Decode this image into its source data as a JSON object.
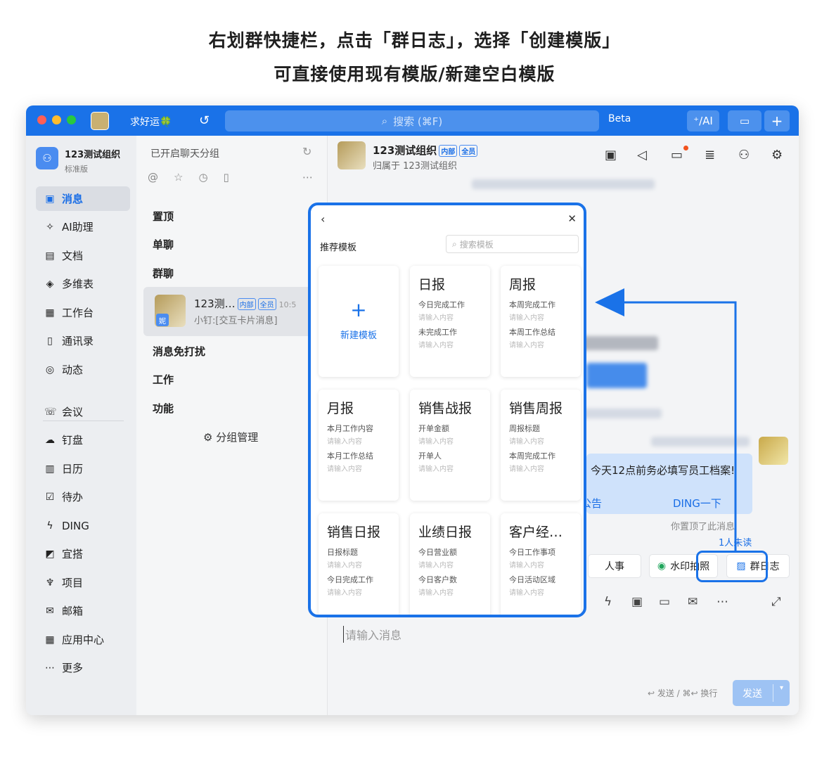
{
  "caption": {
    "line1": "右划群快捷栏，点击「群日志」，选择「创建模版」",
    "line2": "可直接使用现有模版/新建空白模版"
  },
  "titlebar": {
    "status": "求好运🍀",
    "search_placeholder": "搜索 (⌘F)",
    "beta": "Beta",
    "ai_btn": "⁺/AI",
    "add_btn": "+"
  },
  "sidebar": {
    "org_name": "123测试组织",
    "org_edition": "标准版",
    "items": [
      {
        "label": "消息",
        "icon": "message-icon"
      },
      {
        "label": "AI助理",
        "icon": "ai-icon"
      },
      {
        "label": "文档",
        "icon": "doc-icon"
      },
      {
        "label": "多维表",
        "icon": "table-icon"
      },
      {
        "label": "工作台",
        "icon": "grid-icon"
      },
      {
        "label": "通讯录",
        "icon": "contacts-icon"
      },
      {
        "label": "动态",
        "icon": "feed-icon"
      },
      {
        "label": "会议",
        "icon": "meeting-icon"
      },
      {
        "label": "钉盘",
        "icon": "cloud-icon"
      },
      {
        "label": "日历",
        "icon": "calendar-icon"
      },
      {
        "label": "待办",
        "icon": "todo-icon"
      },
      {
        "label": "DING",
        "icon": "ding-icon"
      },
      {
        "label": "宜搭",
        "icon": "yida-icon"
      },
      {
        "label": "项目",
        "icon": "project-icon"
      },
      {
        "label": "邮箱",
        "icon": "mail-icon"
      },
      {
        "label": "应用中心",
        "icon": "apps-icon"
      },
      {
        "label": "更多",
        "icon": "more-icon"
      }
    ]
  },
  "list": {
    "header": "已开启聊天分组",
    "sections": [
      "置顶",
      "单聊",
      "群聊",
      "消息免打扰",
      "工作",
      "功能"
    ],
    "chat": {
      "name": "123测…",
      "tag1": "内部",
      "tag2": "全员",
      "time": "10:5",
      "msg": "小钉:[交互卡片消息]",
      "avatar_text": "妮"
    },
    "group_mgmt": "分组管理"
  },
  "main": {
    "title": "123测试组织",
    "tag1": "内部",
    "tag2": "全员",
    "subtitle": "归属于 123测试组织",
    "notice_text": "今天12点前务必填写员工档案!",
    "notice_action1": "公告",
    "notice_action2": "DING一下",
    "pinned": "你置顶了此消息",
    "unread": "1人未读",
    "shortcut_hr": "人事",
    "shortcut_photo": "水印拍照",
    "shortcut_log": "群日志",
    "input_placeholder": "请输入消息",
    "send_hint": "↩ 发送 / ⌘↩ 换行",
    "send_label": "发送"
  },
  "modal": {
    "head": "推荐模板",
    "search_placeholder": "搜索模板",
    "new_label": "新建模板",
    "cards": [
      {
        "title": "日报",
        "fields": [
          "今日完成工作",
          "未完成工作"
        ]
      },
      {
        "title": "周报",
        "fields": [
          "本周完成工作",
          "本周工作总结"
        ]
      },
      {
        "title": "月报",
        "fields": [
          "本月工作内容",
          "本月工作总结"
        ]
      },
      {
        "title": "销售战报",
        "fields": [
          "开单金额",
          "开单人"
        ]
      },
      {
        "title": "销售周报",
        "fields": [
          "周报标题",
          "本周完成工作"
        ]
      },
      {
        "title": "销售日报",
        "fields": [
          "日报标题",
          "今日完成工作"
        ]
      },
      {
        "title": "业绩日报",
        "fields": [
          "今日营业额",
          "今日客户数"
        ]
      },
      {
        "title": "客户经…",
        "fields": [
          "今日工作事项",
          "今日活动区域"
        ]
      }
    ],
    "field_placeholder": "请输入内容"
  },
  "colors": {
    "accent": "#1a72e8"
  }
}
